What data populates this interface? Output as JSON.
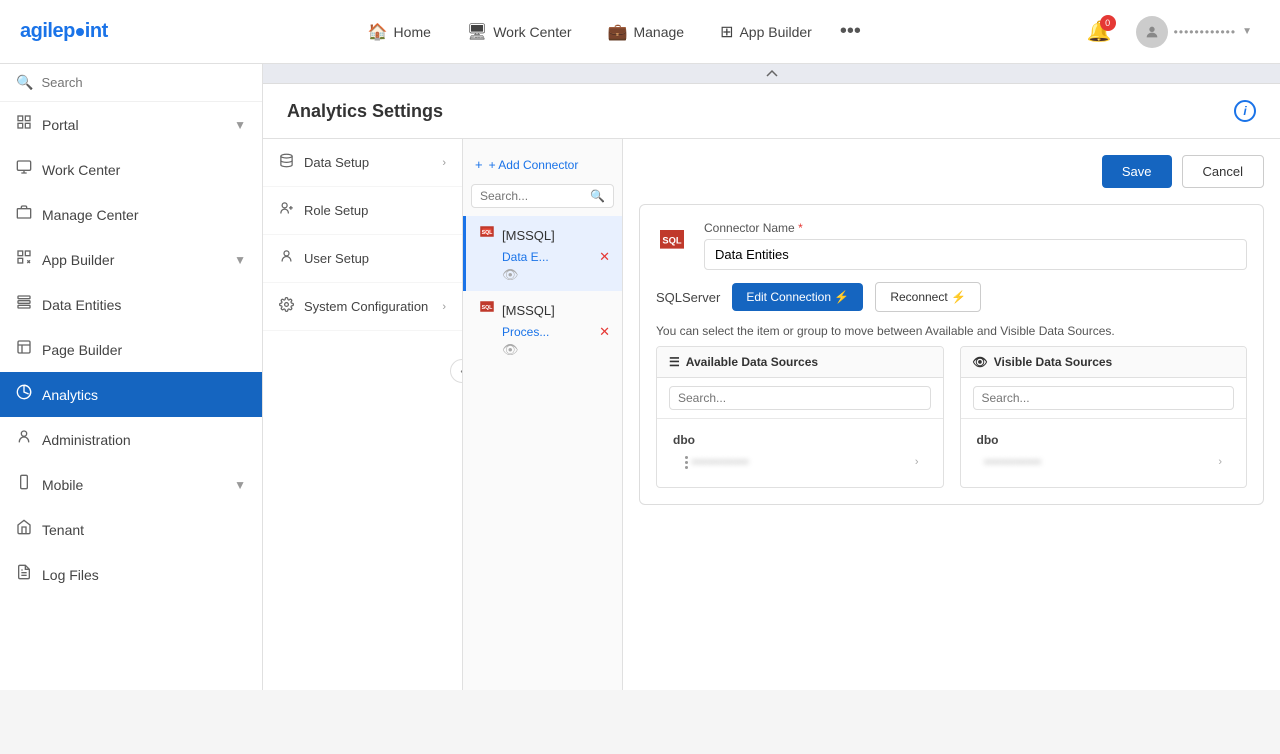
{
  "app": {
    "logo": "agilepoint"
  },
  "top_nav": {
    "items": [
      {
        "id": "home",
        "label": "Home",
        "icon": "🏠"
      },
      {
        "id": "work-center",
        "label": "Work Center",
        "icon": "🖥"
      },
      {
        "id": "manage",
        "label": "Manage",
        "icon": "💼"
      },
      {
        "id": "app-builder",
        "label": "App Builder",
        "icon": "⊞"
      }
    ],
    "more_icon": "•••",
    "bell_badge": "0",
    "user_label": "••••••••••••"
  },
  "sidebar": {
    "search_placeholder": "Search",
    "items": [
      {
        "id": "portal",
        "label": "Portal",
        "has_chevron": true
      },
      {
        "id": "work-center",
        "label": "Work Center",
        "has_chevron": false
      },
      {
        "id": "manage-center",
        "label": "Manage Center",
        "has_chevron": false
      },
      {
        "id": "app-builder",
        "label": "App Builder",
        "has_chevron": true
      },
      {
        "id": "data-entities",
        "label": "Data Entities",
        "has_chevron": false
      },
      {
        "id": "page-builder",
        "label": "Page Builder",
        "has_chevron": false
      },
      {
        "id": "analytics",
        "label": "Analytics",
        "has_chevron": false,
        "active": true
      },
      {
        "id": "administration",
        "label": "Administration",
        "has_chevron": false
      },
      {
        "id": "mobile",
        "label": "Mobile",
        "has_chevron": true
      },
      {
        "id": "tenant",
        "label": "Tenant",
        "has_chevron": false
      },
      {
        "id": "log-files",
        "label": "Log Files",
        "has_chevron": false
      }
    ]
  },
  "page": {
    "title": "Analytics Settings"
  },
  "setup_menu": {
    "items": [
      {
        "id": "data-setup",
        "label": "Data Setup",
        "has_arrow": true
      },
      {
        "id": "role-setup",
        "label": "Role Setup",
        "has_arrow": false
      },
      {
        "id": "user-setup",
        "label": "User Setup",
        "has_arrow": false
      },
      {
        "id": "system-config",
        "label": "System Configuration",
        "has_arrow": true
      }
    ]
  },
  "connectors": {
    "add_label": "+ Add Connector",
    "search_placeholder": "Search...",
    "items": [
      {
        "id": "conn1",
        "type": "[MSSQL]",
        "sub_label": "Data E...",
        "active": true
      },
      {
        "id": "conn2",
        "type": "[MSSQL]",
        "sub_label": "Proces...",
        "active": false
      }
    ]
  },
  "form": {
    "save_label": "Save",
    "cancel_label": "Cancel",
    "connector_name_label": "Connector Name",
    "connector_name_value": "Data Entities",
    "db_type": "SQLServer",
    "edit_conn_label": "Edit Connection ⚡",
    "reconnect_label": "Reconnect ⚡",
    "info_text": "You can select the item or group to move between Available and Visible Data Sources.",
    "available_label": "Available Data Sources",
    "visible_label": "Visible Data Sources",
    "available_search": "Search...",
    "visible_search": "Search...",
    "available_group": "dbo",
    "visible_group": "dbo"
  }
}
